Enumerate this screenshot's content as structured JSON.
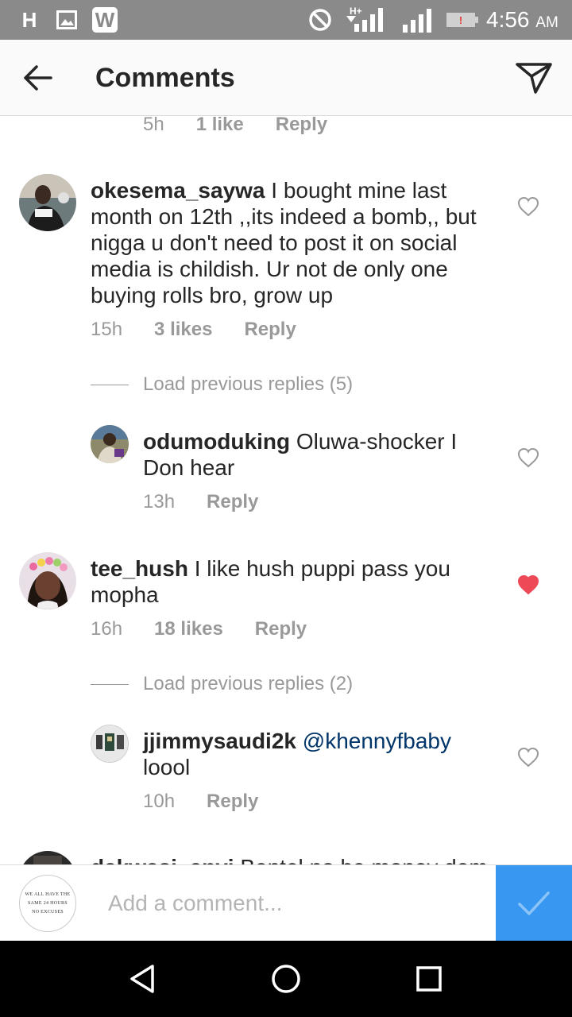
{
  "status_bar": {
    "left_icons": [
      "h-plus-icon",
      "image-icon",
      "w-app-icon"
    ],
    "h_label": "H",
    "w_label": "W",
    "network_label": "H+",
    "time": "4:56",
    "ampm": "AM",
    "battery_alert": "!"
  },
  "header": {
    "title": "Comments"
  },
  "comments": [
    {
      "meta_time": "5h",
      "meta_likes": "1 like",
      "meta_reply": "Reply"
    },
    {
      "username": "okesema_saywa",
      "text": "I bought mine last month on 12th ,,its indeed a bomb,, but nigga u don't need to post it on social media is childish.  Ur not de only one buying rolls bro,  grow up",
      "time": "15h",
      "likes": "3 likes",
      "reply": "Reply",
      "liked": false,
      "load_previous": "Load previous replies (5)",
      "replies": [
        {
          "username": "odumoduking",
          "text": "Oluwa-shocker I Don hear",
          "time": "13h",
          "reply": "Reply",
          "liked": false
        }
      ]
    },
    {
      "username": "tee_hush",
      "text": "I like hush puppi pass you mopha",
      "time": "16h",
      "likes": "18 likes",
      "reply": "Reply",
      "liked": true,
      "load_previous": "Load previous replies (2)",
      "replies": [
        {
          "username": "jjimmysaudi2k",
          "mention": "@khennyfbaby",
          "text": "loool",
          "time": "10h",
          "reply": "Reply",
          "liked": false
        }
      ]
    },
    {
      "username": "dakwasi_enyi",
      "text": "Bentel no be money dem"
    }
  ],
  "composer": {
    "avatar_lines": [
      "WE ALL HAVE THE",
      "SAME 24 HOURS",
      "NO EXCUSES"
    ],
    "placeholder": "Add a comment..."
  },
  "colors": {
    "accent": "#3897f0",
    "liked_heart": "#ed4956",
    "mention": "#003569",
    "meta": "#999999"
  }
}
